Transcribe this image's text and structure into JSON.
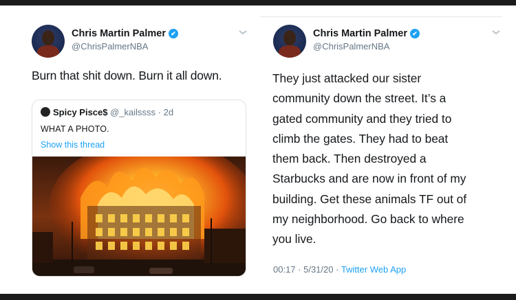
{
  "left_tweet": {
    "author": {
      "name": "Chris Martin Palmer",
      "handle": "@ChrisPalmerNBA"
    },
    "text": "Burn that shit down. Burn it all down.",
    "quote": {
      "author_name": "Spicy Pisce$",
      "author_handle": "@_kailssss",
      "separator": " · ",
      "age": "2d",
      "text": "WHAT A PHOTO.",
      "link": "Show this thread"
    }
  },
  "right_tweet": {
    "author": {
      "name": "Chris Martin Palmer",
      "handle": "@ChrisPalmerNBA"
    },
    "lines": [
      "They just attacked our sister",
      "community down the street. It’s a",
      "gated community and they tried to",
      "climb the gates. They had to beat",
      "them back. Then destroyed a",
      "Starbucks and are now in front of my",
      "building. Get these animals TF out of",
      "my neighborhood. Go back to where",
      "you live."
    ],
    "footer": {
      "time": "00:17",
      "separator": " · ",
      "date": "5/31/20",
      "separator2": " · ",
      "source": "Twitter Web App"
    }
  },
  "colors": {
    "link": "#1da1f2",
    "muted": "#657786",
    "text": "#14171a",
    "verified": "#1da1f2"
  },
  "icons": [
    "verified-badge-icon",
    "chevron-down-icon"
  ]
}
